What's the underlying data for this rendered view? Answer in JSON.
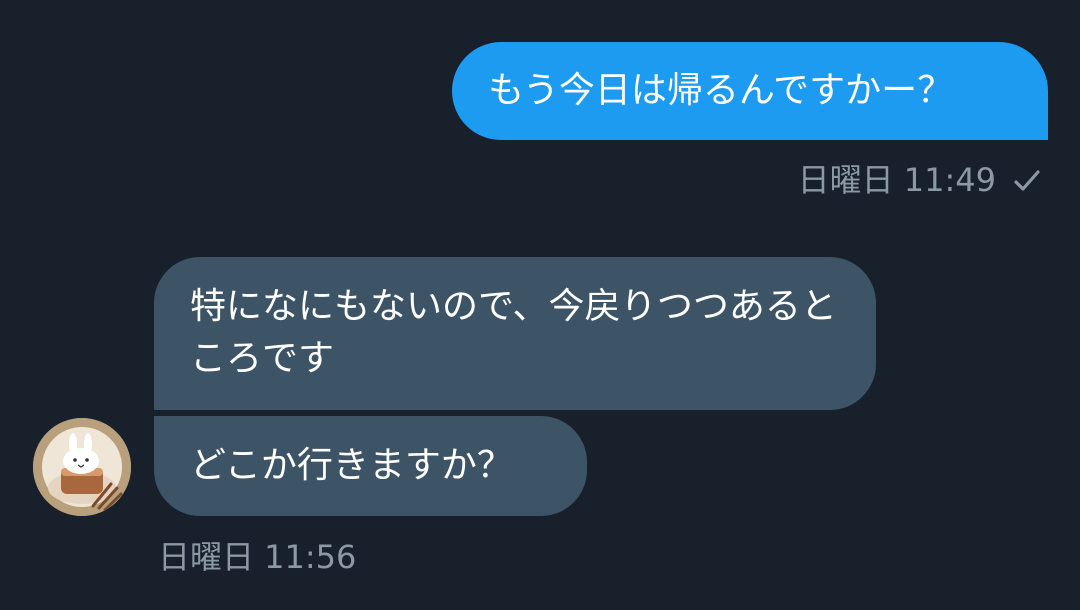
{
  "conversation": {
    "sent": {
      "text": "もう今日は帰るんですかー？",
      "timestamp": "日曜日 11:49",
      "status_icon": "check-icon"
    },
    "received": {
      "messages": [
        {
          "text": "特になにもないので、今戻りつつあるところです"
        },
        {
          "text": "どこか行きますか？"
        }
      ],
      "timestamp": "日曜日 11:56",
      "avatar": "bunny-cake-avatar"
    }
  },
  "colors": {
    "background": "#18202b",
    "sent_bubble": "#1d9bf0",
    "received_bubble": "#3d5466",
    "meta_text": "#8b98a5"
  }
}
